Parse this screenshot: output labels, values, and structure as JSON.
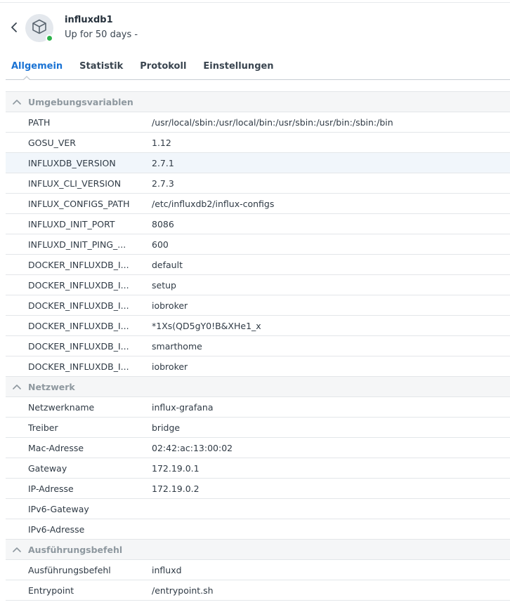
{
  "header": {
    "title": "influxdb1",
    "subtitle": "Up for 50 days -"
  },
  "colors": {
    "accent": "#1a73d4",
    "status_running": "#2db24a"
  },
  "icons": {
    "back": "chevron-left-icon",
    "container": "box-icon",
    "section_toggle": "chevron-up-icon"
  },
  "tabs": [
    {
      "label": "Allgemein",
      "active": true
    },
    {
      "label": "Statistik",
      "active": false
    },
    {
      "label": "Protokoll",
      "active": false
    },
    {
      "label": "Einstellungen",
      "active": false
    }
  ],
  "sections": [
    {
      "title": "Umgebungsvariablen",
      "rows": [
        {
          "key": "PATH",
          "value": "/usr/local/sbin:/usr/local/bin:/usr/sbin:/usr/bin:/sbin:/bin"
        },
        {
          "key": "GOSU_VER",
          "value": "1.12"
        },
        {
          "key": "INFLUXDB_VERSION",
          "value": "2.7.1"
        },
        {
          "key": "INFLUX_CLI_VERSION",
          "value": "2.7.3"
        },
        {
          "key": "INFLUX_CONFIGS_PATH",
          "value": "/etc/influxdb2/influx-configs"
        },
        {
          "key": "INFLUXD_INIT_PORT",
          "value": "8086"
        },
        {
          "key": "INFLUXD_INIT_PING_...",
          "value": "600"
        },
        {
          "key": "DOCKER_INFLUXDB_I...",
          "value": "default"
        },
        {
          "key": "DOCKER_INFLUXDB_I...",
          "value": "setup"
        },
        {
          "key": "DOCKER_INFLUXDB_I...",
          "value": "iobroker"
        },
        {
          "key": "DOCKER_INFLUXDB_I...",
          "value": "*1Xs(QD5gY0!B&XHe1_x"
        },
        {
          "key": "DOCKER_INFLUXDB_I...",
          "value": "smarthome"
        },
        {
          "key": "DOCKER_INFLUXDB_I...",
          "value": "iobroker"
        }
      ]
    },
    {
      "title": "Netzwerk",
      "rows": [
        {
          "key": "Netzwerkname",
          "value": "influx-grafana"
        },
        {
          "key": "Treiber",
          "value": "bridge"
        },
        {
          "key": "Mac-Adresse",
          "value": "02:42:ac:13:00:02"
        },
        {
          "key": "Gateway",
          "value": "172.19.0.1"
        },
        {
          "key": "IP-Adresse",
          "value": "172.19.0.2"
        },
        {
          "key": "IPv6-Gateway",
          "value": ""
        },
        {
          "key": "IPv6-Adresse",
          "value": ""
        }
      ]
    },
    {
      "title": "Ausführungsbefehl",
      "rows": [
        {
          "key": "Ausführungsbefehl",
          "value": "influxd"
        },
        {
          "key": "Entrypoint",
          "value": "/entrypoint.sh"
        }
      ]
    }
  ]
}
